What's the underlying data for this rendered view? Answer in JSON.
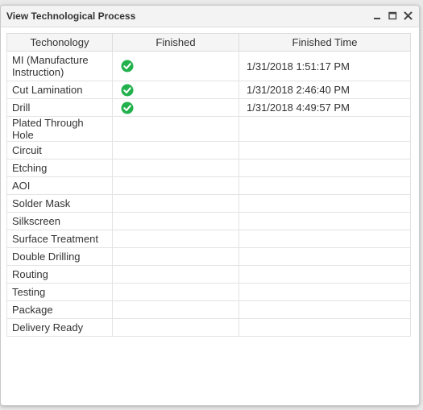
{
  "window": {
    "title": "View Technological Process",
    "controls": {
      "minimize_icon": "minimize-icon",
      "maximize_icon": "maximize-icon",
      "close_icon": "close-icon"
    }
  },
  "table": {
    "headers": [
      "Techonology",
      "Finished",
      "Finished Time"
    ],
    "rows": [
      {
        "technology": "MI (Manufacture Instruction)",
        "finished": true,
        "time": "1/31/2018 1:51:17 PM"
      },
      {
        "technology": "Cut Lamination",
        "finished": true,
        "time": "1/31/2018 2:46:40 PM"
      },
      {
        "technology": "Drill",
        "finished": true,
        "time": "1/31/2018 4:49:57 PM"
      },
      {
        "technology": "Plated Through Hole",
        "finished": false,
        "time": ""
      },
      {
        "technology": "Circuit",
        "finished": false,
        "time": ""
      },
      {
        "technology": "Etching",
        "finished": false,
        "time": ""
      },
      {
        "technology": "AOI",
        "finished": false,
        "time": ""
      },
      {
        "technology": "Solder Mask",
        "finished": false,
        "time": ""
      },
      {
        "technology": "Silkscreen",
        "finished": false,
        "time": ""
      },
      {
        "technology": "Surface Treatment",
        "finished": false,
        "time": ""
      },
      {
        "technology": "Double Drilling",
        "finished": false,
        "time": ""
      },
      {
        "technology": "Routing",
        "finished": false,
        "time": ""
      },
      {
        "technology": "Testing",
        "finished": false,
        "time": ""
      },
      {
        "technology": "Package",
        "finished": false,
        "time": ""
      },
      {
        "technology": "Delivery Ready",
        "finished": false,
        "time": ""
      }
    ],
    "check_icon": "check-circle-icon",
    "check_color": "#22b14c"
  }
}
